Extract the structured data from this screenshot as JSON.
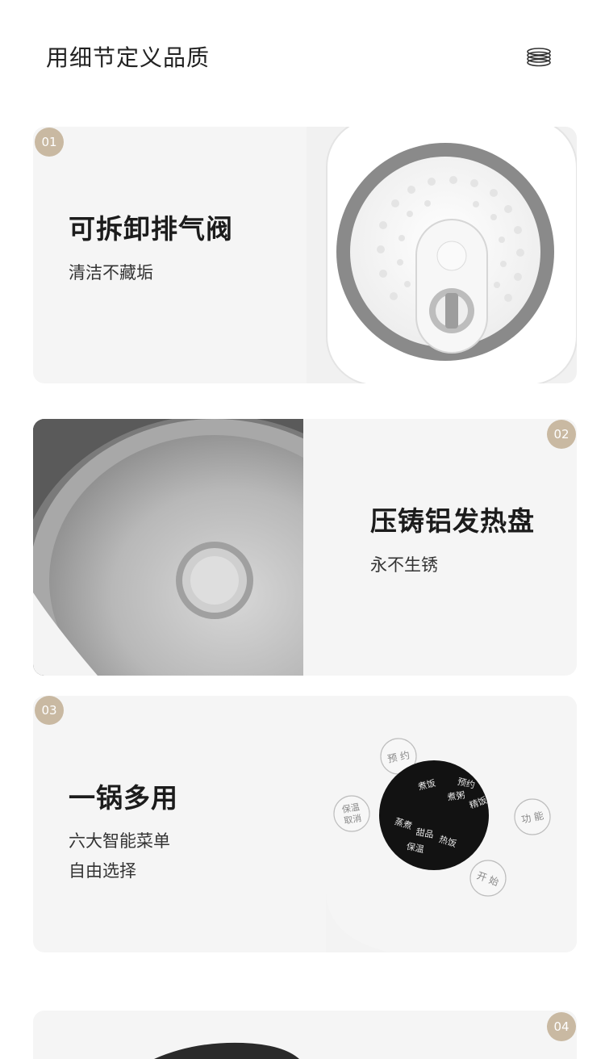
{
  "header": {
    "title": "用细节定义品质",
    "icon": "stacked-rings-icon"
  },
  "features": [
    {
      "number": "01",
      "title": "可拆卸排气阀",
      "lines": [
        "清洁不藏垢"
      ]
    },
    {
      "number": "02",
      "title": "压铸铝发热盘",
      "lines": [
        "永不生锈"
      ]
    },
    {
      "number": "03",
      "title": "一锅多用",
      "lines": [
        "六大智能菜单",
        "自由选择"
      ]
    },
    {
      "number": "04"
    }
  ],
  "control_panel": {
    "buttons": {
      "reserve": "预 约",
      "keep_warm_cancel_1": "保温",
      "keep_warm_cancel_2": "取消",
      "function": "功 能",
      "start": "开 始"
    },
    "display": {
      "cook_rice": "煮饭",
      "reserve": "预约",
      "porridge": "煮粥",
      "quick_rice": "精饭",
      "steam": "蒸煮",
      "dessert": "甜品",
      "reheat": "热饭",
      "keep_warm": "保温"
    }
  },
  "colors": {
    "badge": "#c9b9a2",
    "card_bg": "#f5f5f5"
  }
}
